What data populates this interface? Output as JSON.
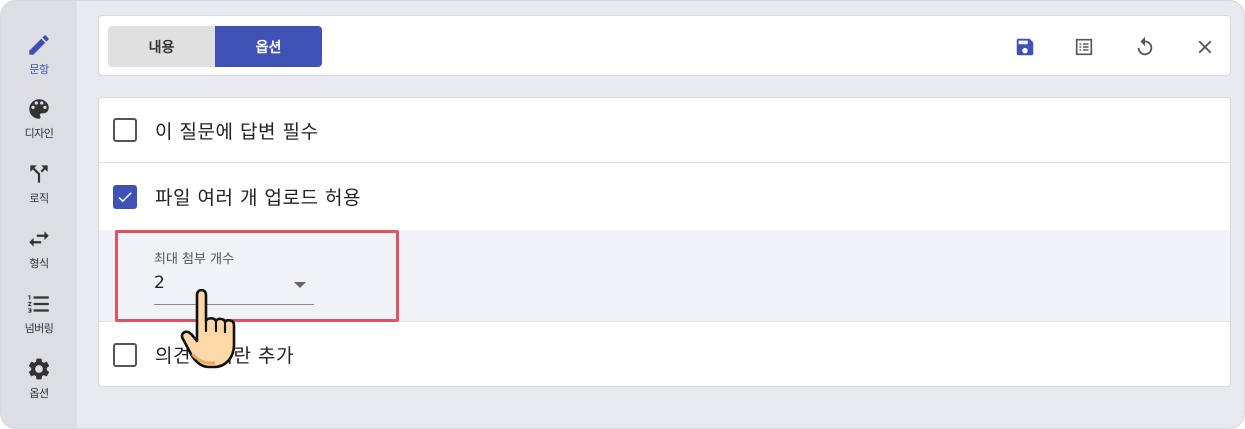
{
  "rail": {
    "items": [
      {
        "label": "문항",
        "icon": "pencil-icon",
        "active": true
      },
      {
        "label": "디자인",
        "icon": "palette-icon"
      },
      {
        "label": "로직",
        "icon": "fork-icon"
      },
      {
        "label": "형식",
        "icon": "swap-arrows-icon"
      },
      {
        "label": "넘버링",
        "icon": "numbered-list-icon"
      },
      {
        "label": "옵션",
        "icon": "gear-icon"
      }
    ]
  },
  "topbar": {
    "tabs": [
      {
        "label": "내용",
        "selected": false
      },
      {
        "label": "옵션",
        "selected": true
      }
    ],
    "tools": [
      "save-icon",
      "list-icon",
      "undo-icon",
      "close-icon"
    ]
  },
  "options": {
    "required": {
      "label": "이 질문에 답변 필수",
      "checked": false
    },
    "multi_upload": {
      "label": "파일 여러 개 업로드 허용",
      "checked": true
    },
    "max_attachments": {
      "label": "최대 첨부 개수",
      "value": "2"
    },
    "comment_field": {
      "label": "의견 입력란 추가",
      "checked": false
    }
  },
  "colors": {
    "accent": "#3f51b5",
    "highlight": "#e0545f",
    "rail_bg": "#dcdee4",
    "page_bg": "#e8eaef"
  }
}
